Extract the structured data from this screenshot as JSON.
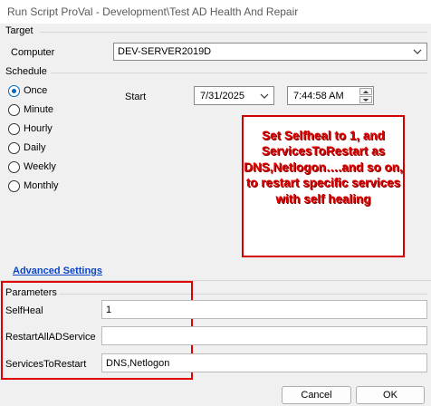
{
  "window": {
    "title": "Run Script ProVal - Development\\Test AD Health And Repair"
  },
  "target": {
    "section_label": "Target",
    "computer_label": "Computer",
    "computer_value": "DEV-SERVER2019D"
  },
  "schedule": {
    "section_label": "Schedule",
    "options": [
      "Once",
      "Minute",
      "Hourly",
      "Daily",
      "Weekly",
      "Monthly"
    ],
    "selected": "Once",
    "start_label": "Start",
    "start_date": "7/31/2025",
    "start_time": "7:44:58 AM"
  },
  "annotation": {
    "text": "Set Selfheal to 1, and ServicesToRestart as DNS,Netlogon….and so on, to restart specific services with self healing",
    "color": "#e00000"
  },
  "advanced_settings": {
    "label": "Advanced Settings"
  },
  "parameters": {
    "section_label": "Parameters",
    "fields": [
      {
        "label": "SelfHeal",
        "value": "1"
      },
      {
        "label": "RestartAllADService",
        "value": ""
      },
      {
        "label": "ServicesToRestart",
        "value": "DNS,Netlogon"
      }
    ]
  },
  "buttons": {
    "cancel": "Cancel",
    "ok": "OK"
  }
}
